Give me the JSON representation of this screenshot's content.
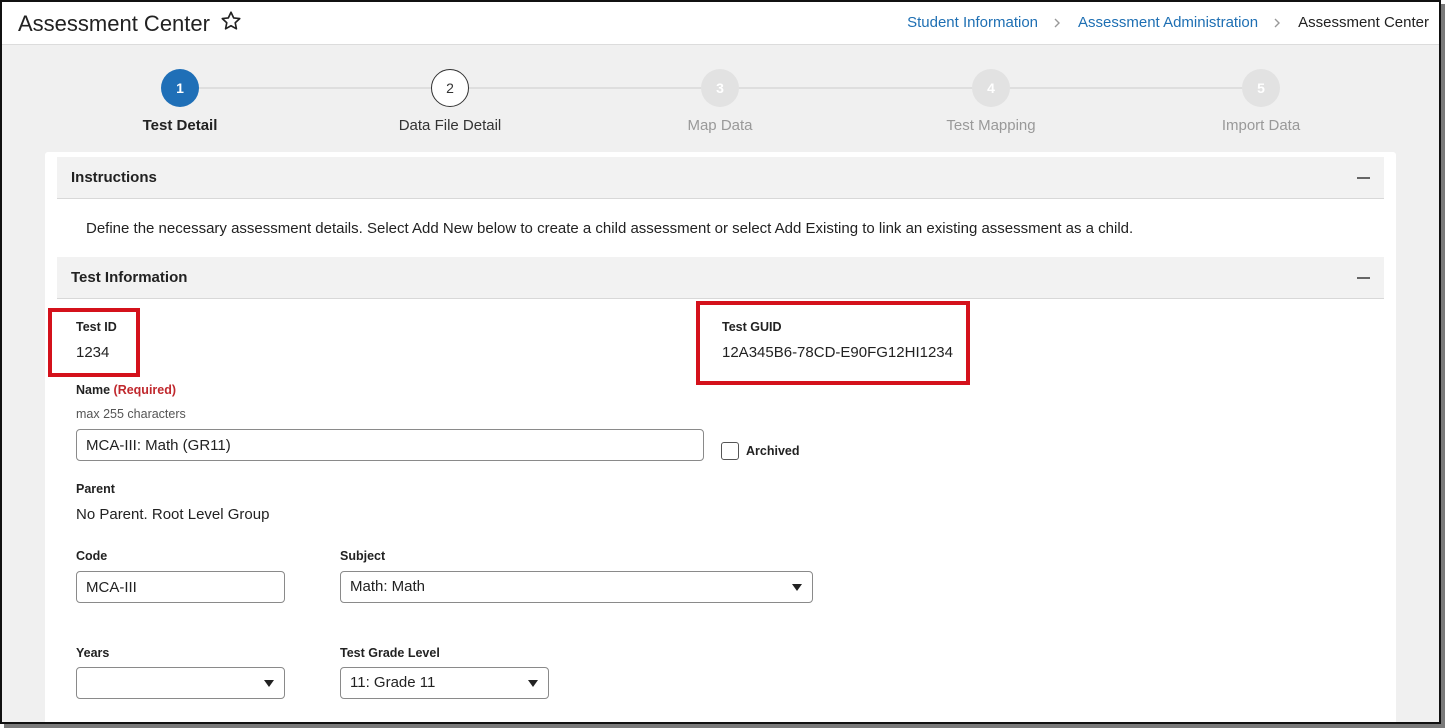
{
  "header": {
    "title": "Assessment Center",
    "breadcrumbs": [
      "Student Information",
      "Assessment Administration"
    ],
    "current": "Assessment Center"
  },
  "steps": [
    {
      "number": "1",
      "label": "Test Detail",
      "state": "active"
    },
    {
      "number": "2",
      "label": "Data File Detail",
      "state": "next"
    },
    {
      "number": "3",
      "label": "Map Data",
      "state": "future"
    },
    {
      "number": "4",
      "label": "Test Mapping",
      "state": "future"
    },
    {
      "number": "5",
      "label": "Import Data",
      "state": "future"
    }
  ],
  "instructions": {
    "title": "Instructions",
    "text": "Define the necessary assessment details. Select Add New below to create a child assessment or select Add Existing to link an existing assessment as a child."
  },
  "test_info": {
    "title": "Test Information",
    "test_id_label": "Test ID",
    "test_id": "1234",
    "test_guid_label": "Test GUID",
    "test_guid": "12A345B6-78CD-E90FG12HI1234",
    "name_label": "Name",
    "name_required": "(Required)",
    "name_hint": "max 255 characters",
    "name_value": "MCA-III: Math (GR11)",
    "archived_label": "Archived",
    "parent_label": "Parent",
    "parent_value": "No Parent. Root Level Group",
    "code_label": "Code",
    "code_value": "MCA-III",
    "subject_label": "Subject",
    "subject_value": "Math: Math",
    "years_label": "Years",
    "years_value": "",
    "grade_label": "Test Grade Level",
    "grade_value": "11: Grade 11"
  },
  "colors": {
    "accent": "#1f6fb7",
    "link": "#1e6fb3",
    "highlight": "#d4111b",
    "required": "#c0282d"
  }
}
